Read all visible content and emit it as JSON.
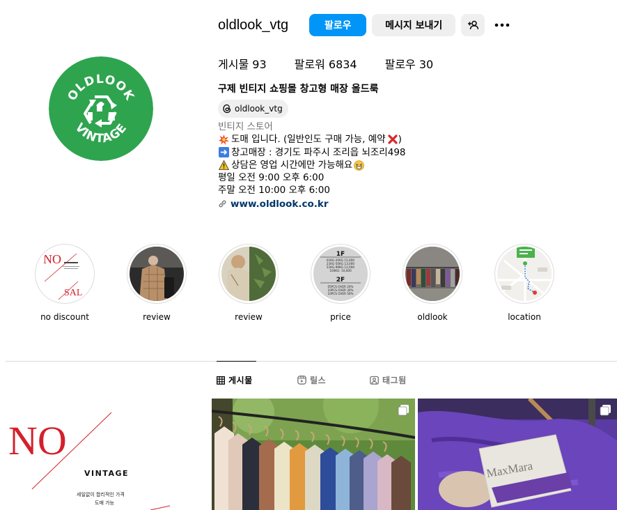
{
  "profile": {
    "username": "oldlook_vtg",
    "follow_label": "팔로우",
    "message_label": "메시지 보내기",
    "avatar_text_top": "OLDLOOK",
    "avatar_text_bottom": "VINTAGE",
    "avatar_color": "#2ea44f"
  },
  "stats": {
    "posts_label": "게시물",
    "posts_count": "93",
    "followers_label": "팔로워",
    "followers_count": "6834",
    "following_label": "팔로우",
    "following_count": "30"
  },
  "bio": {
    "full_name": "구제 빈티지 쇼핑몰 창고형 매장 올드룩",
    "threads_handle": "oldlook_vtg",
    "category": "빈티지 스토어",
    "line1": "도매 입니다. (일반인도 구매 가능, 예약",
    "line1_end": ")",
    "line2": "창고매장 : 경기도 파주시 조리읍 뇌조리498",
    "line3": "상담은 영업 시간에만 가능해요",
    "line4": "평일 오전 9:00 오후 6:00",
    "line5": "주말 오전 10:00 오후 6:00",
    "link": "www.oldlook.co.kr"
  },
  "highlights": [
    {
      "label": "no discount"
    },
    {
      "label": "review"
    },
    {
      "label": "review"
    },
    {
      "label": "price"
    },
    {
      "label": "oldlook"
    },
    {
      "label": "location"
    }
  ],
  "price_card": {
    "floor1": "1F",
    "floor1_lines": [
      "01KG-20KG 15,000",
      "21KG-50KG 13,000",
      "51KG-99KG 12,000",
      "100KG-   10,000"
    ],
    "floor2": "2F",
    "floor2_lines": [
      "05PCS OVER 20%",
      "10PCS OVER 30%",
      "10PCS OVER 50%"
    ]
  },
  "tabs": {
    "posts": "게시물",
    "reels": "릴스",
    "tagged": "태그됨"
  },
  "post1": {
    "no_text": "NO",
    "vintage_text": "VINTAGE",
    "desc_line1": "세일없이 합리적인 가격",
    "desc_line2": "도매 가능"
  },
  "post3": {
    "brand_label": "MaxMara"
  },
  "colors": {
    "accent": "#0095f6",
    "link": "#00376b",
    "brand_green": "#2ea44f",
    "no_red": "#d4202b"
  }
}
